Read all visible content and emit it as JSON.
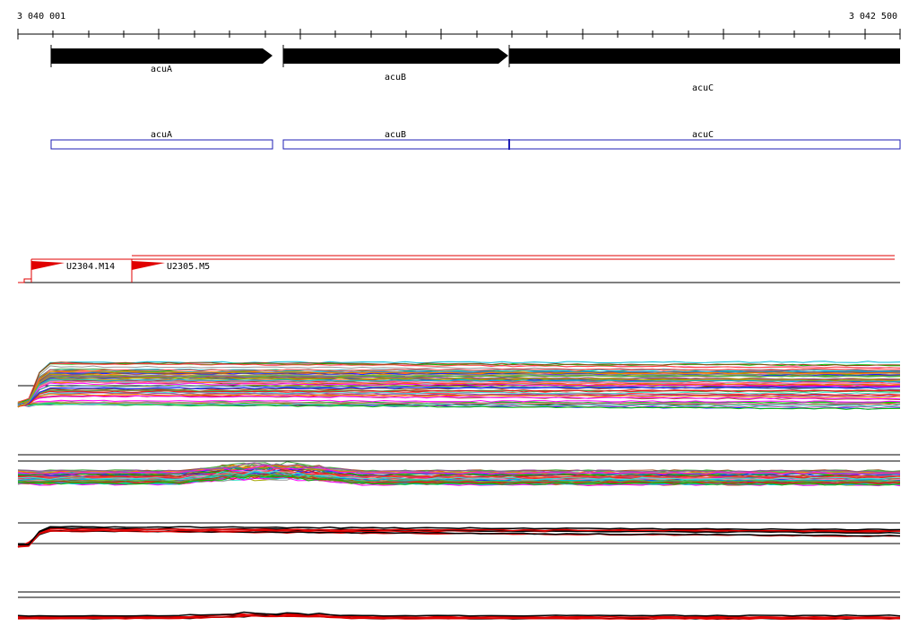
{
  "ruler": {
    "start_label": "3 040 001",
    "end_label": "3 042 500"
  },
  "genes": [
    {
      "name": "acuA",
      "strand": "+"
    },
    {
      "name": "acuB",
      "strand": "+"
    },
    {
      "name": "acuC",
      "strand": "+"
    }
  ],
  "cds": [
    {
      "name": "acuA"
    },
    {
      "name": "acuB"
    },
    {
      "name": "acuC"
    }
  ],
  "promoters": [
    {
      "name": "U2304.M14"
    },
    {
      "name": "U2305.M5"
    }
  ],
  "colors": {
    "gene_arrow": "#000000",
    "cds_box": "#1f1fb4",
    "promoter": "#e00000",
    "track_red": "#e00000",
    "track_black": "#000000",
    "palette": [
      "#e41a1c",
      "#377eb8",
      "#4daf4a",
      "#984ea3",
      "#ff7f00",
      "#a6a600",
      "#a65628",
      "#f781bf",
      "#999999",
      "#00bcd4",
      "#ff00ff",
      "#1a1aff",
      "#00c000",
      "#ff4040",
      "#8b4513",
      "#40e0d0"
    ]
  }
}
